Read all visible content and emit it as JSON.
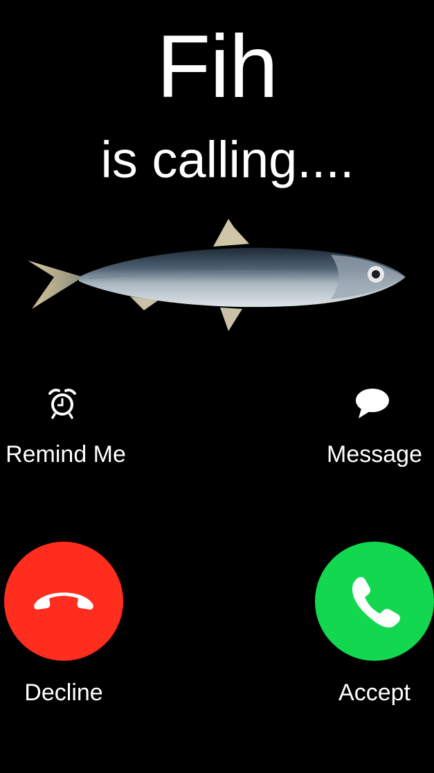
{
  "caller": {
    "name": "Fih",
    "status": "is calling...."
  },
  "actions": {
    "remind_label": "Remind Me",
    "message_label": "Message"
  },
  "call_buttons": {
    "decline_label": "Decline",
    "accept_label": "Accept"
  },
  "colors": {
    "background": "#000000",
    "decline": "#ff2d1e",
    "accept": "#13d84f",
    "text": "#ffffff"
  },
  "icons": {
    "remind": "alarm-clock-icon",
    "message": "speech-bubble-icon",
    "decline": "phone-hangup-icon",
    "accept": "phone-icon"
  }
}
